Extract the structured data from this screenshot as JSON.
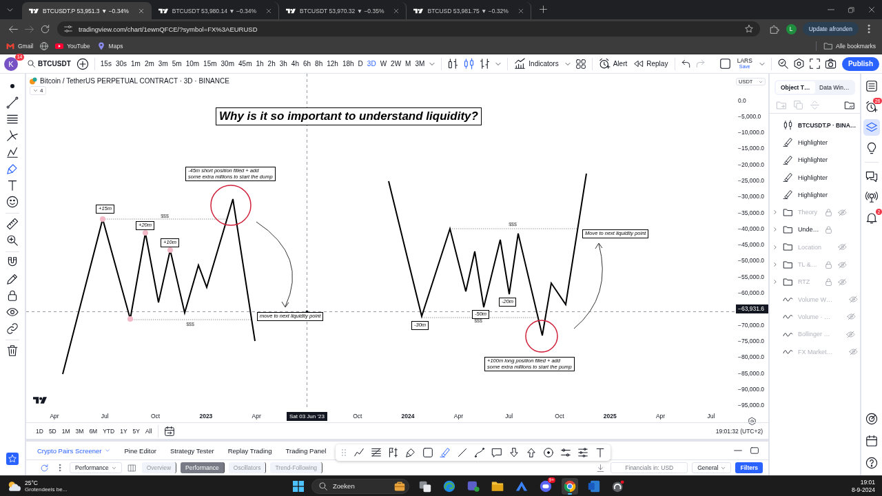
{
  "browser": {
    "tabs": [
      {
        "title": "BTCUSDT.P 53,951.3 ▼ −0.34%",
        "selected": true
      },
      {
        "title": "BTCUSDT 53,980.14 ▼ −0.34%",
        "selected": false
      },
      {
        "title": "BTCUSDT 53,970.32 ▼ −0.35%",
        "selected": false
      },
      {
        "title": "BTCUSD 53,981.75 ▼ −0.32%",
        "selected": false
      }
    ],
    "url": "tradingview.com/chart/1ewnQFCE/?symbol=FX%3AEURUSD",
    "profile_initial": "L",
    "update_button": "Update afronden",
    "bookmarks": [
      {
        "kind": "mail",
        "label": "Gmail"
      },
      {
        "kind": "globe"
      },
      {
        "kind": "video",
        "label": "YouTube"
      },
      {
        "kind": "map",
        "label": "Maps"
      }
    ],
    "all_bookmarks": "Alle bookmarks"
  },
  "toolbar": {
    "avatar_initial": "K",
    "avatar_badge": "14",
    "symbol": "BTCUSDT",
    "intervals": [
      {
        "label": "15s",
        "selected": false
      },
      {
        "label": "30s",
        "selected": false
      },
      {
        "label": "1m",
        "selected": false
      },
      {
        "label": "2m",
        "selected": false
      },
      {
        "label": "3m",
        "selected": false
      },
      {
        "label": "5m",
        "selected": false
      },
      {
        "label": "10m",
        "selected": false
      },
      {
        "label": "15m",
        "selected": false
      },
      {
        "label": "30m",
        "selected": false
      },
      {
        "label": "45m",
        "selected": false
      },
      {
        "label": "1h",
        "selected": false
      },
      {
        "label": "2h",
        "selected": false
      },
      {
        "label": "3h",
        "selected": false
      },
      {
        "label": "4h",
        "selected": false
      },
      {
        "label": "6h",
        "selected": false
      },
      {
        "label": "8h",
        "selected": false
      },
      {
        "label": "12h",
        "selected": false
      },
      {
        "label": "18h",
        "selected": false
      },
      {
        "label": "D",
        "selected": false
      },
      {
        "label": "3D",
        "selected": true
      },
      {
        "label": "W",
        "selected": false
      },
      {
        "label": "2W",
        "selected": false
      },
      {
        "label": "M",
        "selected": false
      },
      {
        "label": "3M",
        "selected": false
      }
    ],
    "indicators": "Indicators",
    "alert": "Alert",
    "replay": "Replay",
    "layout_name": "LARS",
    "layout_status": "Save",
    "publish": "Publish"
  },
  "left_toolbar": [
    {
      "selected": false
    },
    {
      "selected": false
    },
    {
      "selected": false
    },
    {
      "selected": false
    },
    {
      "selected": false
    },
    {
      "selected": true
    },
    {
      "selected": false
    },
    {
      "selected": false
    },
    {
      "selected": false
    },
    {
      "selected": false
    },
    {
      "selected": false
    },
    {
      "selected": false
    },
    {
      "selected": false
    },
    {
      "selected": false
    },
    {
      "selected": false
    },
    {
      "selected": false
    }
  ],
  "chart": {
    "legend": "Bitcoin / TetherUS PERPETUAL CONTRACT · 3D · BINANCE",
    "legend_count": "4",
    "currency": "USDT",
    "annotations": [
      {
        "kind": "title",
        "text": "Why is it so important to understand liquidity?"
      },
      {
        "kind": "box",
        "text": "-45m short position filled + add\nsome extra millions to start the dump"
      },
      {
        "kind": "box",
        "text": "+15m"
      },
      {
        "kind": "plain",
        "text": "$$$"
      },
      {
        "kind": "box",
        "text": "+20m"
      },
      {
        "kind": "box",
        "text": "+10m"
      },
      {
        "kind": "plain",
        "text": "$$$"
      },
      {
        "kind": "box",
        "text": "move to next liquidity point"
      },
      {
        "kind": "box",
        "text": "Move to next liquidity point"
      },
      {
        "kind": "plain",
        "text": "$$$"
      },
      {
        "kind": "box",
        "text": "-50m"
      },
      {
        "kind": "box",
        "text": "-20m"
      },
      {
        "kind": "box",
        "text": "-30m"
      },
      {
        "kind": "plain",
        "text": "$$$"
      },
      {
        "kind": "box",
        "text": "+100m long position filled + add\nsome extra millions to start the pump"
      }
    ],
    "price_axis": [
      {
        "kind": "tick",
        "label": "0.0"
      },
      {
        "kind": "tick",
        "label": "−5,000.0"
      },
      {
        "kind": "tick",
        "label": "−10,000.0"
      },
      {
        "kind": "tick",
        "label": "−15,000.0"
      },
      {
        "kind": "tick",
        "label": "−20,000.0"
      },
      {
        "kind": "tick",
        "label": "−25,000.0"
      },
      {
        "kind": "tick",
        "label": "−30,000.0"
      },
      {
        "kind": "tick",
        "label": "−35,000.0"
      },
      {
        "kind": "tick",
        "label": "−40,000.0"
      },
      {
        "kind": "tick",
        "label": "−45,000.0"
      },
      {
        "kind": "tick",
        "label": "−50,000.0"
      },
      {
        "kind": "tick",
        "label": "−55,000.0"
      },
      {
        "kind": "tick",
        "label": "−60,000.0"
      },
      {
        "kind": "current",
        "label": "−63,931.6"
      },
      {
        "kind": "tick",
        "label": "−70,000.0"
      },
      {
        "kind": "tick",
        "label": "−75,000.0"
      },
      {
        "kind": "tick",
        "label": "−80,000.0"
      },
      {
        "kind": "tick",
        "label": "−85,000.0"
      },
      {
        "kind": "tick",
        "label": "−90,000.0"
      },
      {
        "kind": "tick",
        "label": "−95,000.0"
      }
    ],
    "time_axis": [
      {
        "kind": "month",
        "label": "Apr"
      },
      {
        "kind": "month",
        "label": "Jul"
      },
      {
        "kind": "month",
        "label": "Oct"
      },
      {
        "kind": "year",
        "label": "2023"
      },
      {
        "kind": "month",
        "label": "Apr"
      },
      {
        "kind": "crosshair",
        "label": "Sat 03 Jun '23"
      },
      {
        "kind": "month",
        "label": "Oct"
      },
      {
        "kind": "year",
        "label": "2024"
      },
      {
        "kind": "month",
        "label": "Apr"
      },
      {
        "kind": "month",
        "label": "Jul"
      },
      {
        "kind": "month",
        "label": "Oct"
      },
      {
        "kind": "year",
        "label": "2025"
      },
      {
        "kind": "month",
        "label": "Apr"
      },
      {
        "kind": "month",
        "label": "Jul"
      }
    ]
  },
  "range_bar": {
    "ranges": [
      "1D",
      "5D",
      "1M",
      "3M",
      "6M",
      "YTD",
      "1Y",
      "5Y",
      "All"
    ],
    "clock": "19:01:32 (UTC+2)"
  },
  "bottom_panel": {
    "tabs": [
      {
        "kind": "dropdown",
        "label": "Crypto Pairs Screener",
        "selected": true
      },
      {
        "kind": "tab",
        "label": "Pine Editor",
        "selected": false
      },
      {
        "kind": "tab",
        "label": "Strategy Tester",
        "selected": false
      },
      {
        "kind": "tab",
        "label": "Replay Trading",
        "selected": false
      },
      {
        "kind": "tab",
        "label": "Trading Panel",
        "selected": false
      }
    ],
    "drawing_toolbar": [
      {
        "selected": false
      },
      {
        "selected": false
      },
      {
        "selected": false
      },
      {
        "selected": false
      },
      {
        "selected": false
      },
      {
        "selected": true
      },
      {
        "selected": false
      },
      {
        "selected": false
      },
      {
        "selected": false
      },
      {
        "selected": false
      },
      {
        "selected": false
      },
      {
        "selected": false
      },
      {
        "selected": false
      },
      {
        "selected": false
      },
      {
        "selected": false
      }
    ],
    "screener_bar": [
      {
        "kind": "dropdown",
        "label": "Performance"
      },
      {
        "kind": "tab",
        "label": "Overview",
        "selected": false
      },
      {
        "kind": "tab",
        "label": "Performance",
        "selected": true
      },
      {
        "kind": "tab",
        "label": "Oscillators",
        "selected": false
      },
      {
        "kind": "tab",
        "label": "Trend-Following",
        "selected": false
      },
      {
        "kind": "field",
        "label": "Financials in: USD"
      },
      {
        "kind": "dropdown",
        "label": "General"
      },
      {
        "kind": "button",
        "label": "Filters"
      }
    ]
  },
  "object_tree": {
    "tabs": [
      {
        "label": "Object T…",
        "selected": true
      },
      {
        "label": "Data Win…",
        "selected": false
      }
    ],
    "items": [
      {
        "kind": "symbol",
        "label": "BTCUSDT.P · BINA…",
        "locked": false,
        "hidden": false
      },
      {
        "kind": "drawing",
        "label": "Highlighter",
        "locked": false,
        "hidden": false
      },
      {
        "kind": "drawing",
        "label": "Highlighter",
        "locked": false,
        "hidden": false
      },
      {
        "kind": "drawing",
        "label": "Highlighter",
        "locked": false,
        "hidden": false
      },
      {
        "kind": "drawing",
        "label": "Highlighter",
        "locked": false,
        "hidden": false
      },
      {
        "kind": "folder",
        "label": "Theory",
        "locked": true,
        "hidden": true,
        "expanded": false
      },
      {
        "kind": "folder",
        "label": "Unde…",
        "locked": true,
        "hidden": false,
        "expanded": false
      },
      {
        "kind": "folder",
        "label": "Location",
        "locked": false,
        "hidden": true,
        "expanded": false
      },
      {
        "kind": "folder",
        "label": "TL &…",
        "locked": true,
        "hidden": true,
        "expanded": false
      },
      {
        "kind": "folder",
        "label": "RTZ",
        "locked": true,
        "hidden": true,
        "expanded": false
      },
      {
        "kind": "indicator",
        "label": "Volume W…",
        "locked": false,
        "hidden": true
      },
      {
        "kind": "indicator",
        "label": "Volume · …",
        "locked": false,
        "hidden": true
      },
      {
        "kind": "indicator",
        "label": "Bollinger …",
        "locked": false,
        "hidden": true
      },
      {
        "kind": "indicator",
        "label": "FX Market…",
        "locked": false,
        "hidden": true
      }
    ]
  },
  "right_toolbar": [
    {
      "selected": false
    },
    {
      "selected": false,
      "badge": "26"
    },
    {
      "selected": true
    },
    {
      "selected": false
    },
    {
      "selected": false
    },
    {
      "selected": false
    },
    {
      "selected": false,
      "badge": "2"
    }
  ],
  "taskbar": {
    "temperature": "25°C",
    "weather": "Grotendeels be...",
    "search": {
      "placeholder": "Zoeken"
    },
    "apps": [
      {
        "kind": "taskview",
        "selected": false
      },
      {
        "kind": "swirl",
        "selected": false
      },
      {
        "kind": "team",
        "selected": false
      },
      {
        "kind": "folder",
        "selected": false
      },
      {
        "kind": "mountain",
        "selected": false
      },
      {
        "kind": "controller",
        "selected": false,
        "badge": "9+"
      },
      {
        "kind": "browser",
        "selected": true
      },
      {
        "kind": "document",
        "selected": false
      },
      {
        "kind": "gauge",
        "selected": false
      }
    ],
    "time": "19:01",
    "date": "8-9-2024"
  }
}
